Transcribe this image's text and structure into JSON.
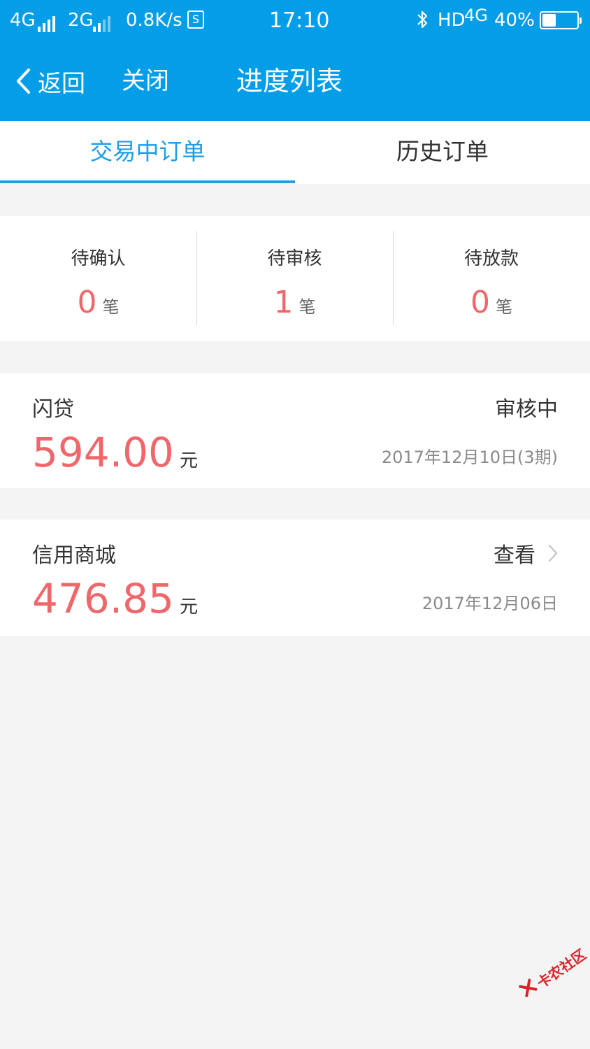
{
  "status_bar": {
    "net1": "4G",
    "net2": "2G",
    "speed": "0.8K/s",
    "s_icon_label": "S",
    "time": "17:10",
    "hd": "HD",
    "net3": "4G",
    "battery": "40%",
    "battery_level": 0.4
  },
  "nav": {
    "back_label": "返回",
    "close_label": "关闭",
    "title": "进度列表"
  },
  "tabs": [
    {
      "label": "交易中订单",
      "active": true
    },
    {
      "label": "历史订单",
      "active": false
    }
  ],
  "stats": [
    {
      "label": "待确认",
      "value": "0",
      "unit": "笔"
    },
    {
      "label": "待审核",
      "value": "1",
      "unit": "笔"
    },
    {
      "label": "待放款",
      "value": "0",
      "unit": "笔"
    }
  ],
  "orders": [
    {
      "name": "闪贷",
      "status": "审核中",
      "amount": "594.00",
      "unit": "元",
      "date": "2017年12月10日(3期)"
    },
    {
      "name": "信用商城",
      "action": "查看",
      "amount": "476.85",
      "unit": "元",
      "date": "2017年12月06日"
    }
  ],
  "watermark": {
    "text": "卡农社区"
  },
  "colors": {
    "header_bg": "#049ee8",
    "accent": "#1d9ee6",
    "amount_red": "#f0676b",
    "page_bg": "#f4f4f4"
  }
}
